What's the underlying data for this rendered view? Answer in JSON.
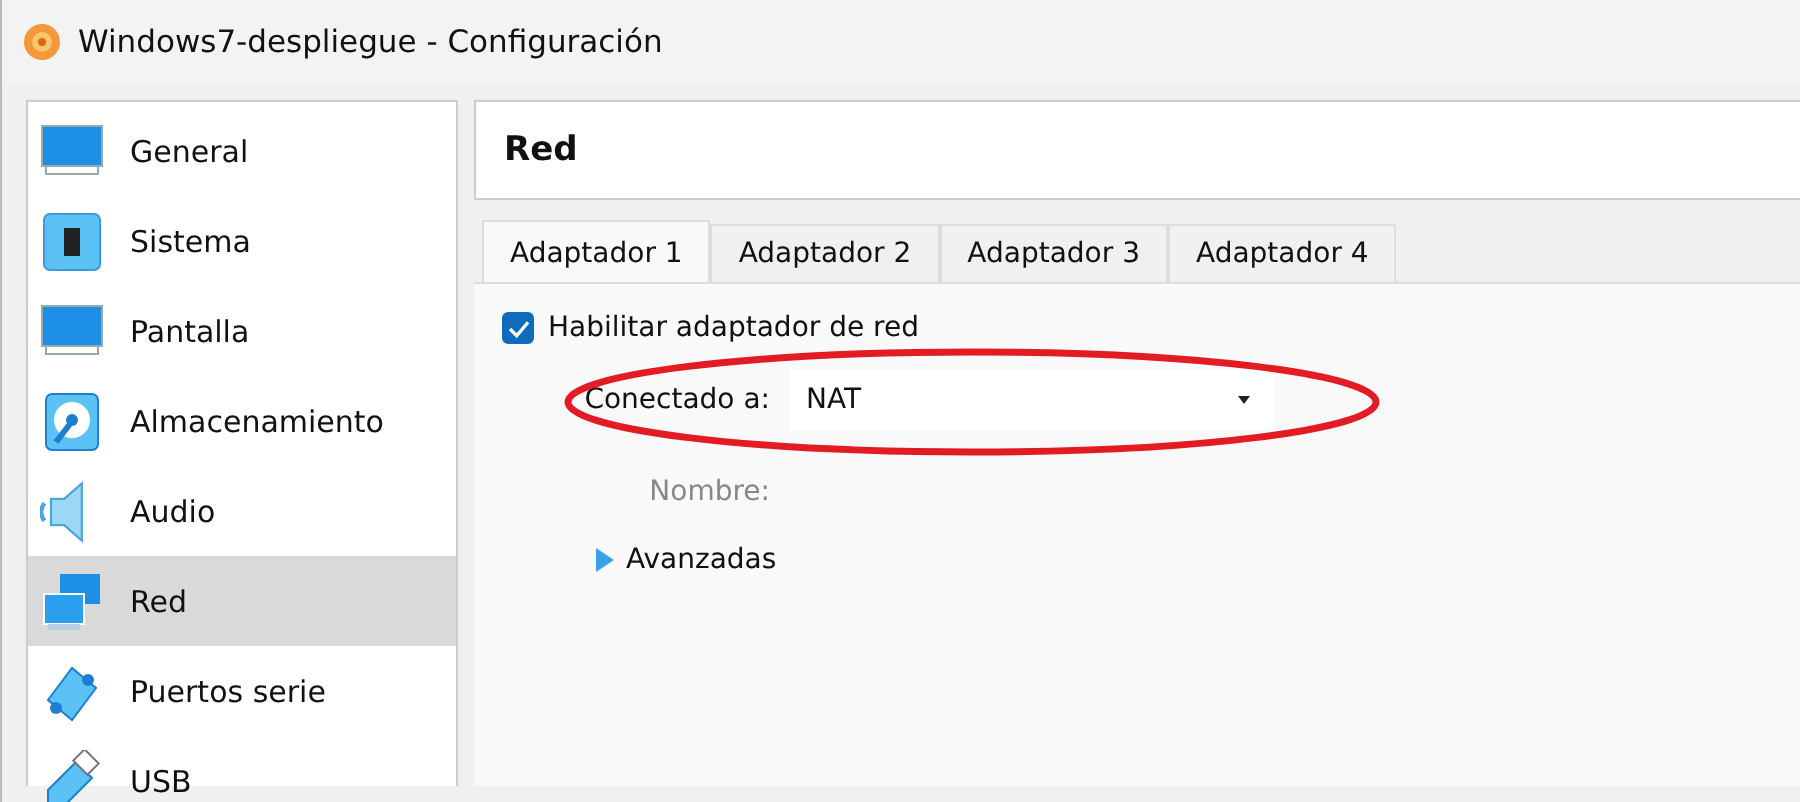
{
  "window": {
    "title": "Windows7-despliegue - Configuración"
  },
  "sidebar": {
    "items": [
      {
        "label": "General",
        "selected": false
      },
      {
        "label": "Sistema",
        "selected": false
      },
      {
        "label": "Pantalla",
        "selected": false
      },
      {
        "label": "Almacenamiento",
        "selected": false
      },
      {
        "label": "Audio",
        "selected": false
      },
      {
        "label": "Red",
        "selected": true
      },
      {
        "label": "Puertos serie",
        "selected": false
      },
      {
        "label": "USB",
        "selected": false
      }
    ]
  },
  "page": {
    "title": "Red"
  },
  "tabs": [
    {
      "label": "Adaptador 1",
      "selected": true
    },
    {
      "label": "Adaptador 2",
      "selected": false
    },
    {
      "label": "Adaptador 3",
      "selected": false
    },
    {
      "label": "Adaptador 4",
      "selected": false
    }
  ],
  "enable_adapter": {
    "label": "Habilitar adaptador de red",
    "checked": true
  },
  "attached_to": {
    "label": "Conectado a:",
    "value": "NAT"
  },
  "name": {
    "label": "Nombre:",
    "disabled": true
  },
  "advanced": {
    "label": "Avanzadas",
    "expanded": false
  }
}
